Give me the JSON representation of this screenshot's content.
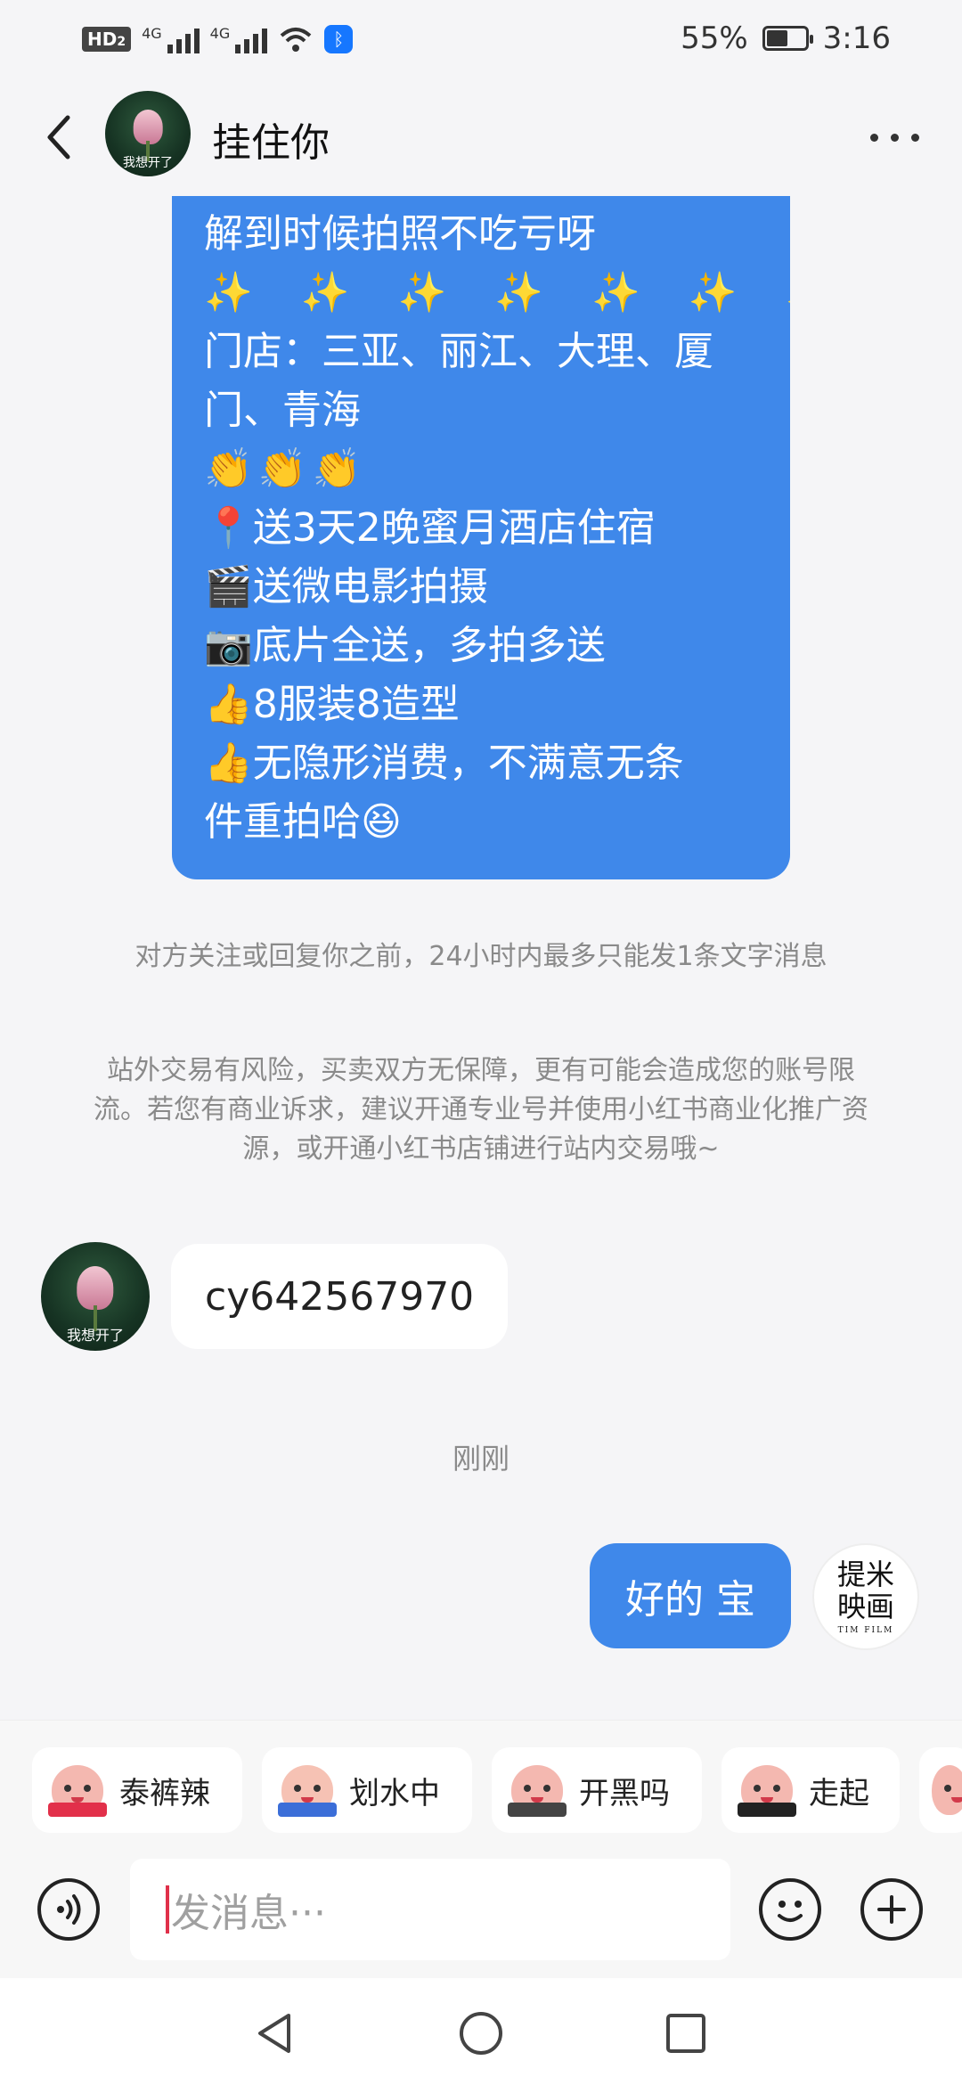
{
  "status_bar": {
    "hd_label": "HD",
    "hd_sub": "2",
    "network_1": "4G",
    "network_2": "4G",
    "battery_percent": "55%",
    "battery_level": 0.55,
    "time": "3:16"
  },
  "header": {
    "title": "挂住你",
    "avatar_caption": "我想开了"
  },
  "promo_bubble": {
    "lines": [
      "解到时候拍照不吃亏呀",
      "✨ ✨ ✨ ✨ ✨ ✨ ✨ ✨",
      "门店：三亚、丽江、大理、厦",
      "门、青海",
      "👏👏👏",
      "📍送3天2晚蜜月酒店住宿",
      "🎬送微电影拍摄",
      "📷底片全送，多拍多送",
      "👍8服装8造型",
      "👍无隐形消费，不满意无条",
      "件重拍哈😆"
    ]
  },
  "notices": {
    "limit": "对方关注或回复你之前，24小时内最多只能发1条文字消息",
    "risk": "站外交易有风险，买卖双方无保障，更有可能会造成您的账号限流。若您有商业诉求，建议开通专业号并使用小红书商业化推广资源，或开通小红书店铺进行站内交易哦~"
  },
  "messages": {
    "incoming_text": "cy642567970",
    "incoming_avatar_caption": "我想开了",
    "timestamp": "刚刚",
    "outgoing_text": "好的 宝",
    "my_avatar_line1": "提米",
    "my_avatar_line2": "映画",
    "my_avatar_sub": "TIM FILM"
  },
  "stickers": [
    {
      "label": "泰裤辣",
      "icon": "sticker-tai-ku-la-icon"
    },
    {
      "label": "划水中",
      "icon": "sticker-hua-shui-icon"
    },
    {
      "label": "开黑吗",
      "icon": "sticker-kai-hei-icon"
    },
    {
      "label": "走起",
      "icon": "sticker-zou-qi-icon"
    }
  ],
  "input": {
    "placeholder": "发消息···"
  },
  "colors": {
    "bubble_blue": "#3f88ea",
    "background": "#f5f5f7"
  }
}
